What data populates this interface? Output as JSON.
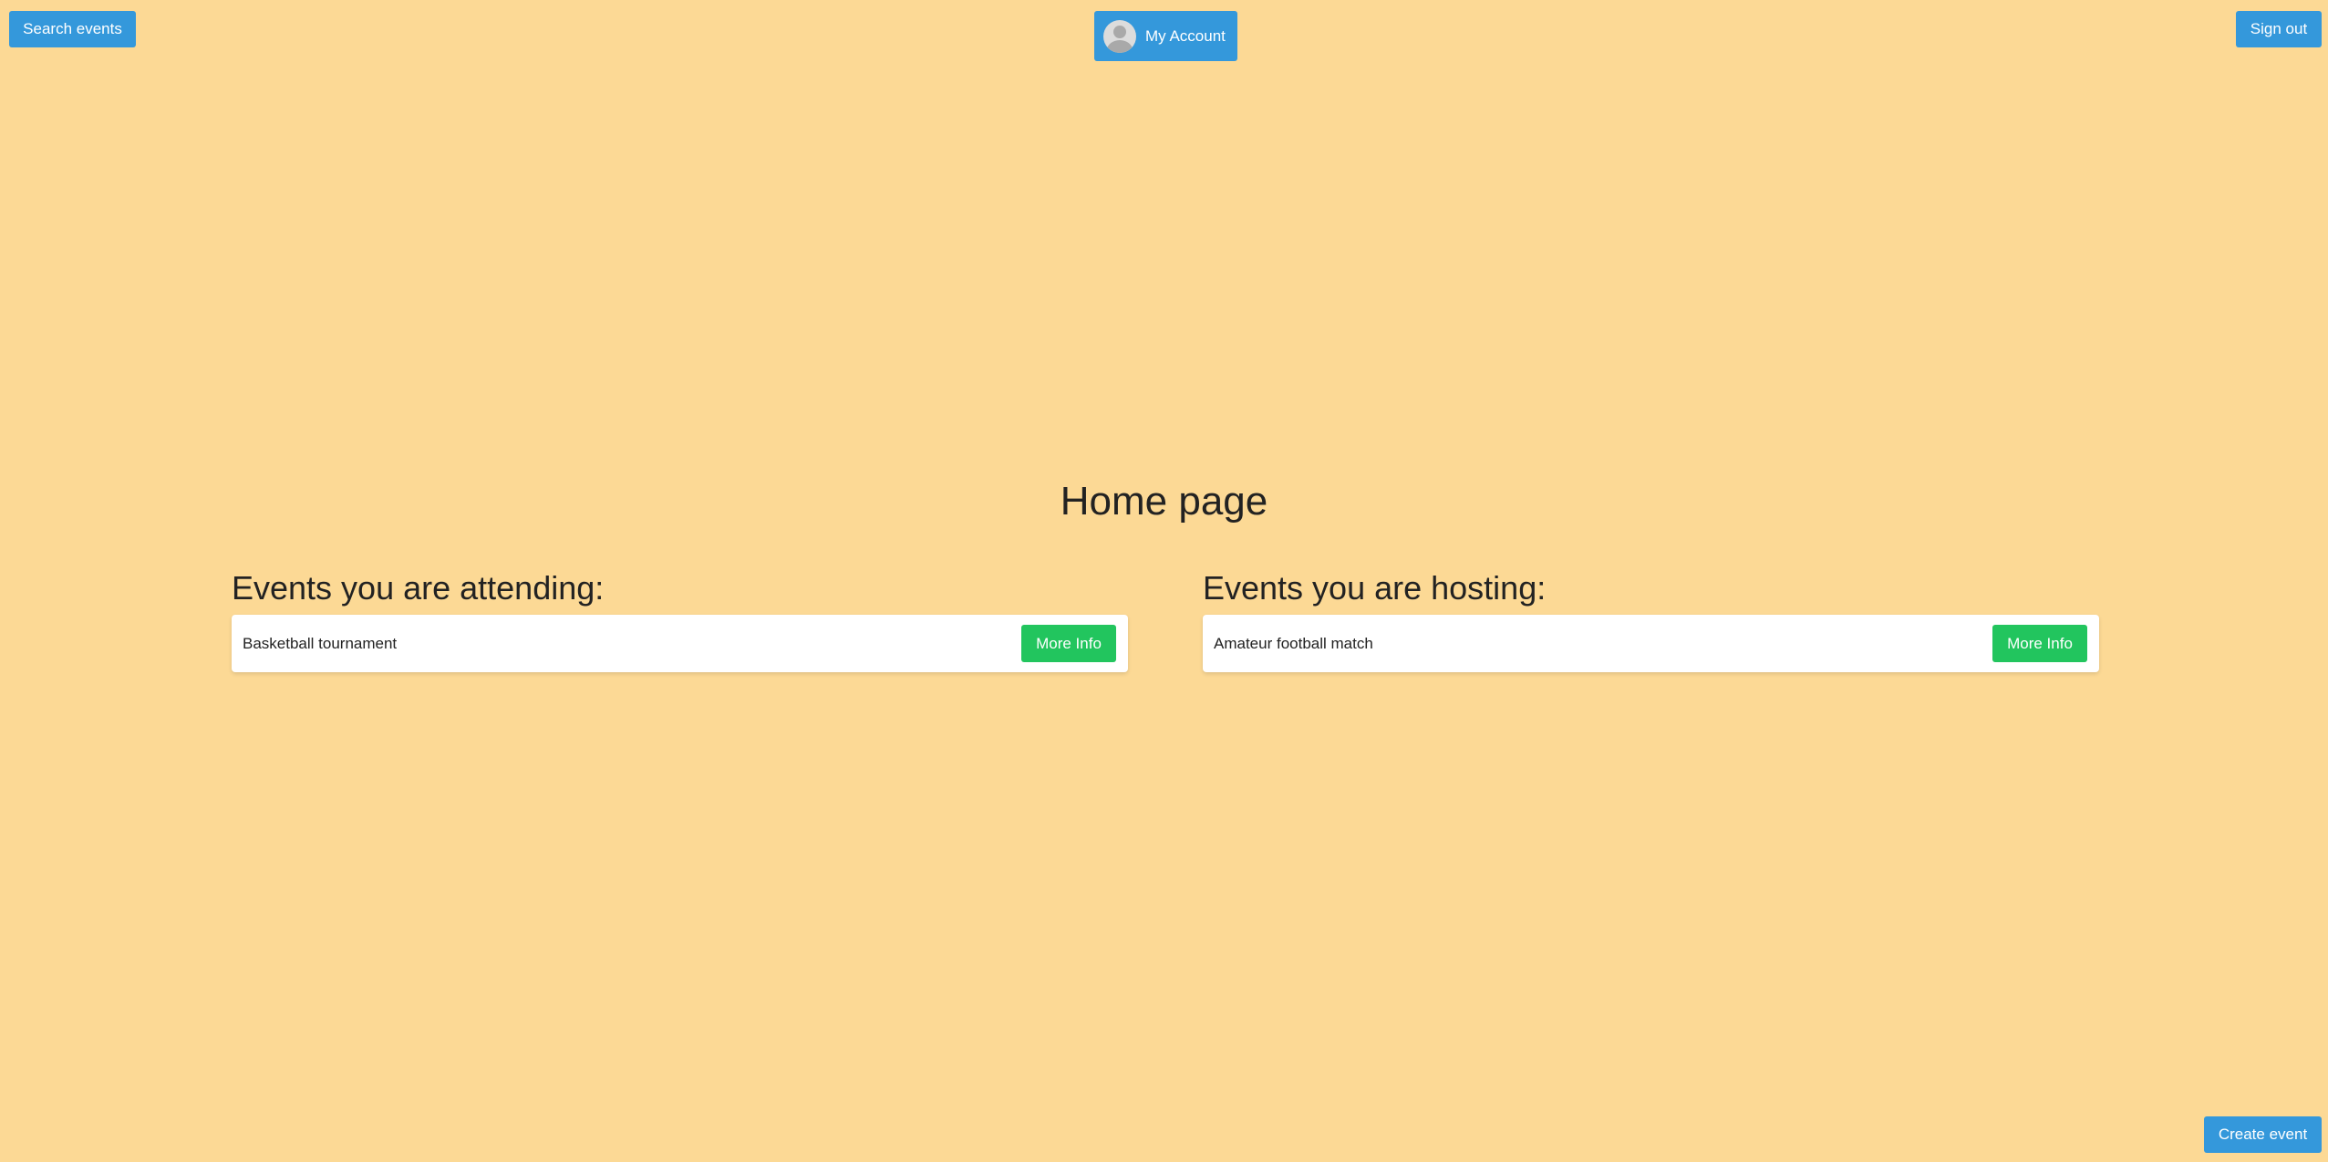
{
  "header": {
    "search_label": "Search events",
    "account_label": "My Account",
    "signout_label": "Sign out"
  },
  "main": {
    "title": "Home page",
    "attending": {
      "heading": "Events you are attending:",
      "events": [
        {
          "name": "Basketball tournament",
          "button_label": "More Info"
        }
      ]
    },
    "hosting": {
      "heading": "Events you are hosting:",
      "events": [
        {
          "name": "Amateur football match",
          "button_label": "More Info"
        }
      ]
    }
  },
  "footer": {
    "create_label": "Create event"
  },
  "colors": {
    "background": "#fcd995",
    "primary_button": "#3498db",
    "success_button": "#22c55e"
  },
  "icons": {
    "avatar": "user-avatar-icon"
  }
}
